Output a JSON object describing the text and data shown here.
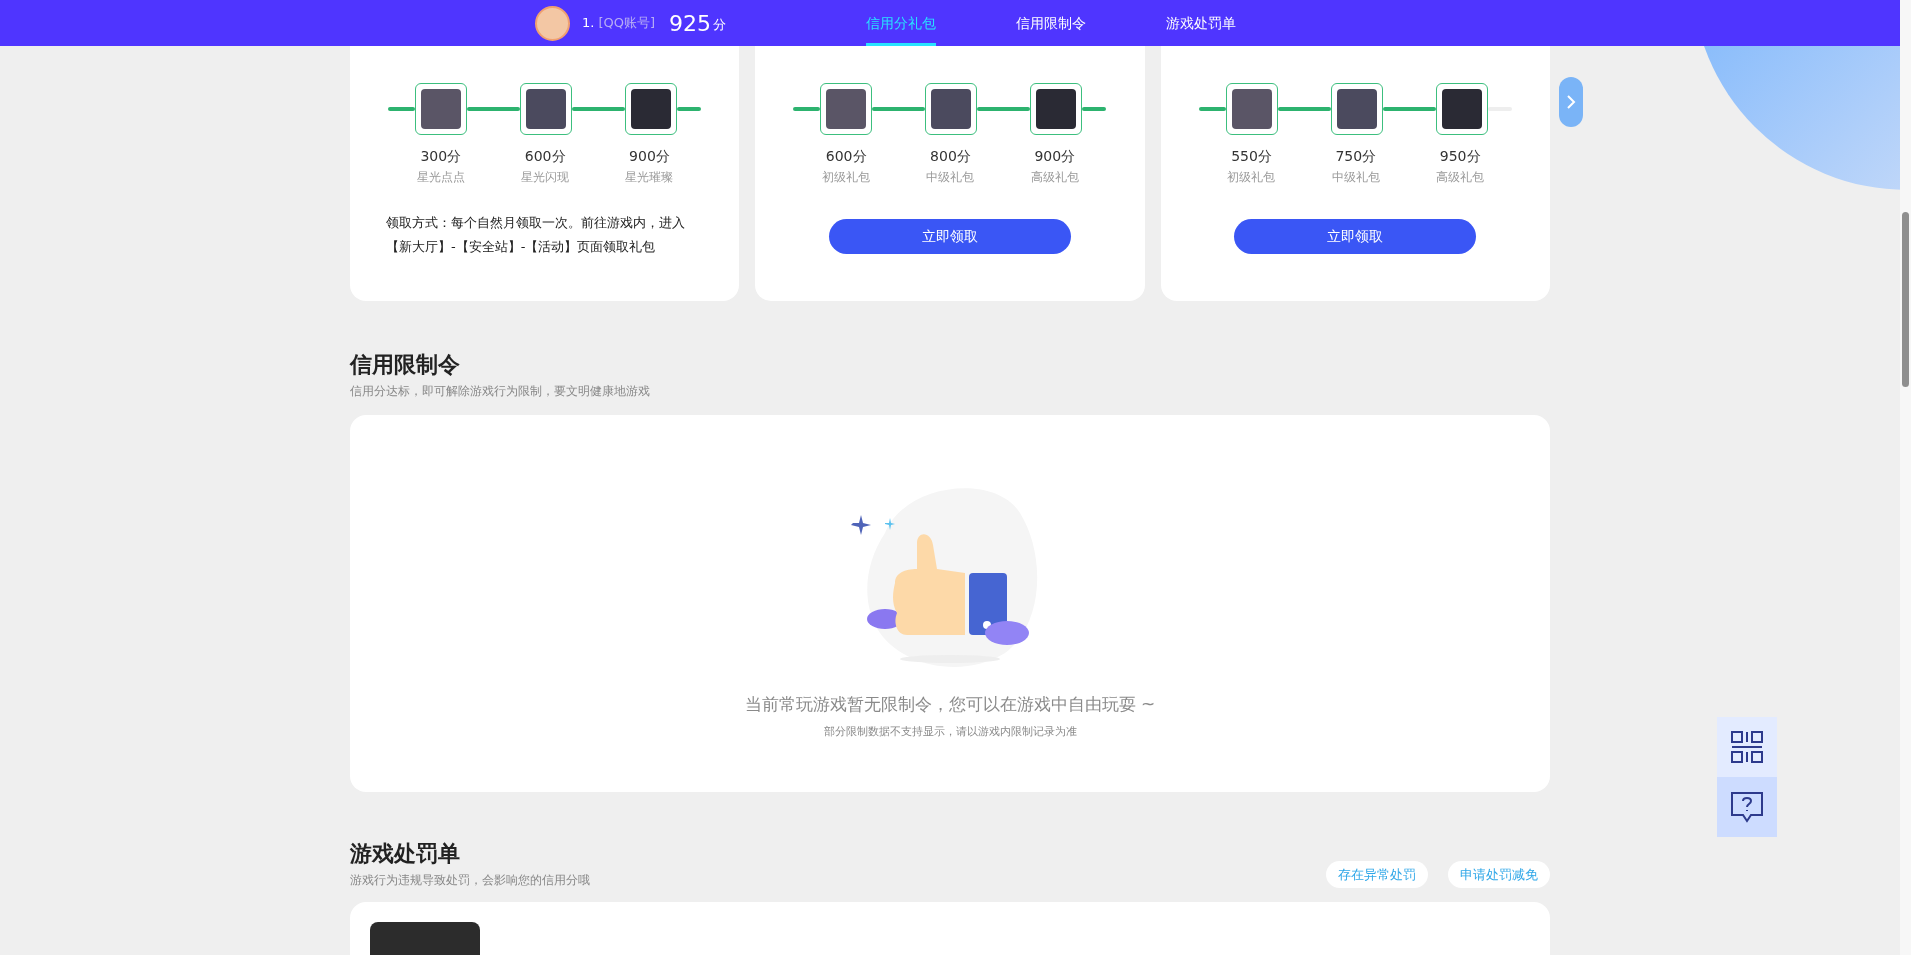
{
  "header": {
    "rank": "1.",
    "account": "[QQ账号]",
    "score": "925",
    "score_unit": "分"
  },
  "nav_tabs": [
    {
      "label": "信用分礼包",
      "selected": true
    },
    {
      "label": "信用限制令",
      "selected": false
    },
    {
      "label": "游戏处罚单",
      "selected": false
    }
  ],
  "gift_cards": [
    {
      "track": [
        {
          "reached": true
        },
        {
          "reached": true
        },
        {
          "reached": true
        },
        {
          "reached": true
        }
      ],
      "items": [
        {
          "points": "300分",
          "name": "星光点点"
        },
        {
          "points": "600分",
          "name": "星光闪现"
        },
        {
          "points": "900分",
          "name": "星光璀璨"
        }
      ],
      "description": "领取方式：每个自然月领取一次。前往游戏内，进入【新大厅】-【安全站】-【活动】页面领取礼包"
    },
    {
      "track": [
        {
          "reached": true
        },
        {
          "reached": true
        },
        {
          "reached": true
        },
        {
          "reached": true
        }
      ],
      "items": [
        {
          "points": "600分",
          "name": "初级礼包"
        },
        {
          "points": "800分",
          "name": "中级礼包"
        },
        {
          "points": "900分",
          "name": "高级礼包"
        }
      ],
      "button": "立即领取"
    },
    {
      "track": [
        {
          "reached": true
        },
        {
          "reached": true
        },
        {
          "reached": true
        },
        {
          "reached": false
        }
      ],
      "items": [
        {
          "points": "550分",
          "name": "初级礼包"
        },
        {
          "points": "750分",
          "name": "中级礼包"
        },
        {
          "points": "950分",
          "name": "高级礼包"
        }
      ],
      "button": "立即领取"
    }
  ],
  "restriction_section": {
    "title": "信用限制令",
    "subtitle": "信用分达标，即可解除游戏行为限制，要文明健康地游戏",
    "empty_message": "当前常玩游戏暂无限制令，您可以在游戏中自由玩耍 ~",
    "empty_note": "部分限制数据不支持显示，请以游戏内限制记录为准"
  },
  "penalty_section": {
    "title": "游戏处罚单",
    "subtitle": "游戏行为违规导致处罚，会影响您的信用分哦",
    "actions": [
      "存在异常处罚",
      "申请处罚减免"
    ]
  }
}
